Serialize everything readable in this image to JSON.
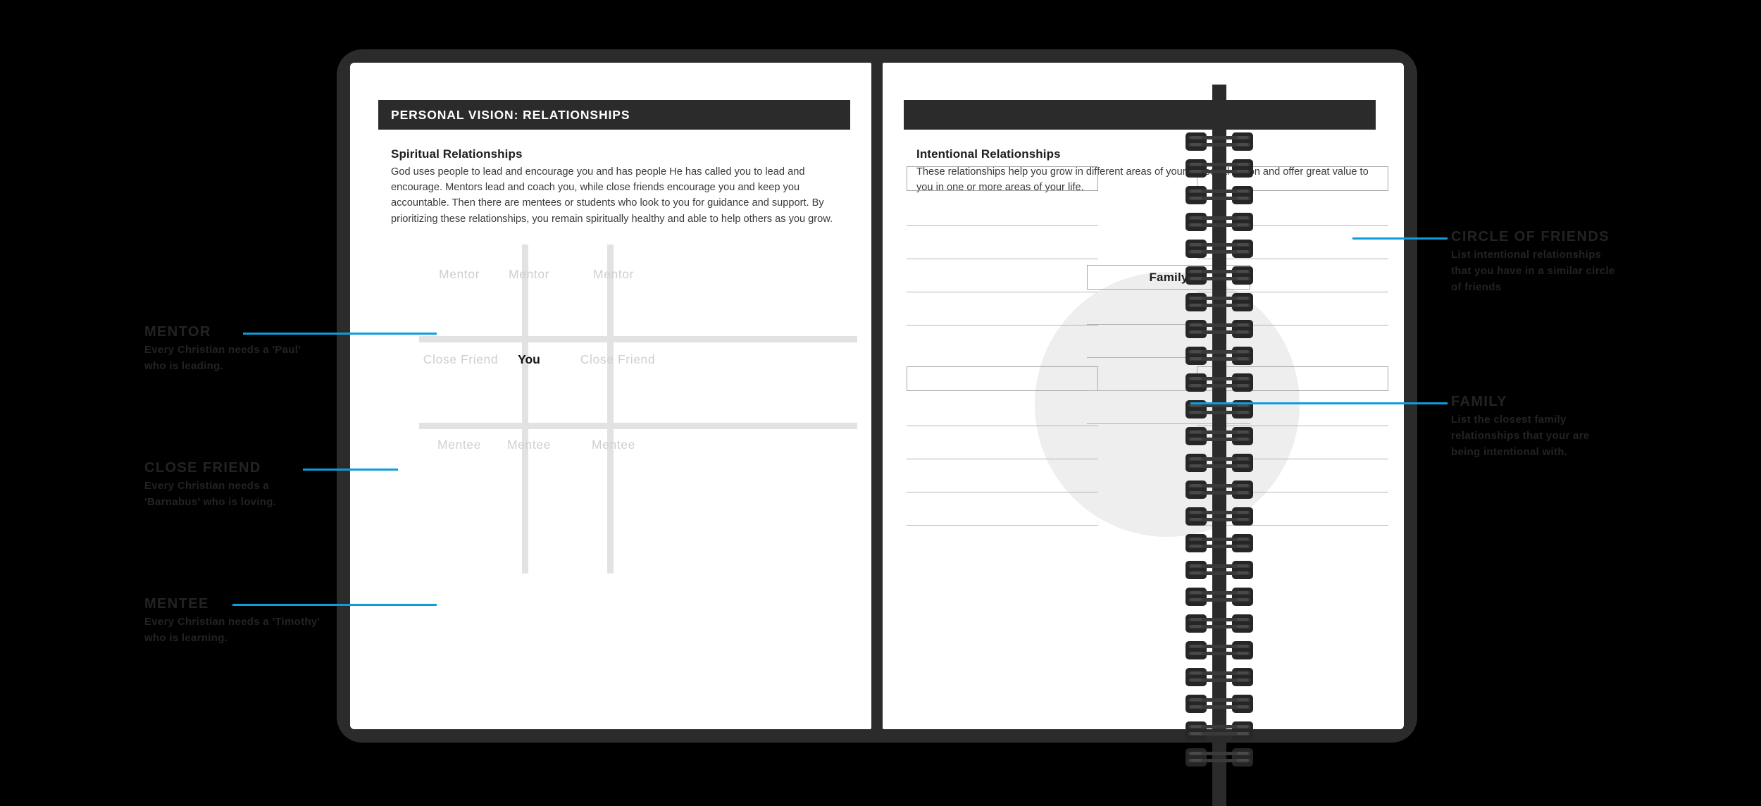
{
  "theme": {
    "background": "#000000",
    "cover": "#2b2b2b",
    "page": "#ffffff",
    "accent_blue": "#0D9DDC",
    "annotation_text": "#232323",
    "grid_line": "#e2e2e2",
    "rule_line": "#b4b4b4",
    "circle_fill": "#eeeeee",
    "placeholder_text": "#cfcfcf"
  },
  "left_page": {
    "header": "PERSONAL VISION: RELATIONSHIPS",
    "section": {
      "heading": "Spiritual Relationships",
      "body": "God uses people to lead and encourage you and has people He has called you to lead and encourage. Mentors lead and coach you, while close friends encourage you and keep you accountable. Then there are mentees or students who look to you for guidance and support. By prioritizing these relationships, you remain spiritually healthy and able to help others as you grow."
    },
    "grid": {
      "rows": [
        {
          "cells": [
            "Mentor",
            "Mentor",
            "Mentor"
          ]
        },
        {
          "cells": [
            "Close Friend",
            "You",
            "Close Friend"
          ]
        },
        {
          "cells": [
            "Mentee",
            "Mentee",
            "Mentee"
          ]
        }
      ],
      "center_label": "You"
    }
  },
  "right_page": {
    "header": "",
    "section": {
      "heading": "Intentional Relationships",
      "body": "These relationships help you grow in different areas of your Personal Vision and offer great value to you in one or more areas of your life."
    },
    "diagram": {
      "center_label": "Family",
      "quadrants": [
        {
          "position": "top-left",
          "label": "",
          "line_count": 4
        },
        {
          "position": "top-right",
          "label": "",
          "line_count": 4
        },
        {
          "position": "bottom-left",
          "label": "",
          "line_count": 4
        },
        {
          "position": "bottom-right",
          "label": "",
          "line_count": 4
        }
      ],
      "center_line_count": 4
    }
  },
  "annotations": {
    "left": [
      {
        "id": "mentor",
        "title": "MENTOR",
        "body": "Every Christian needs a 'Paul' who is leading."
      },
      {
        "id": "close-friend",
        "title": "CLOSE FRIEND",
        "body": "Every Christian needs a 'Barnabus' who is loving."
      },
      {
        "id": "mentee",
        "title": "MENTEE",
        "body": "Every Christian needs a 'Timothy' who is learning."
      }
    ],
    "right": [
      {
        "id": "circle-of-friends",
        "title": "CIRCLE OF FRIENDS",
        "body": "List intentional relationships that you have in a similar circle of friends"
      },
      {
        "id": "family",
        "title": "FAMILY",
        "body": "List the closest family relationships that your are being intentional with."
      }
    ]
  }
}
